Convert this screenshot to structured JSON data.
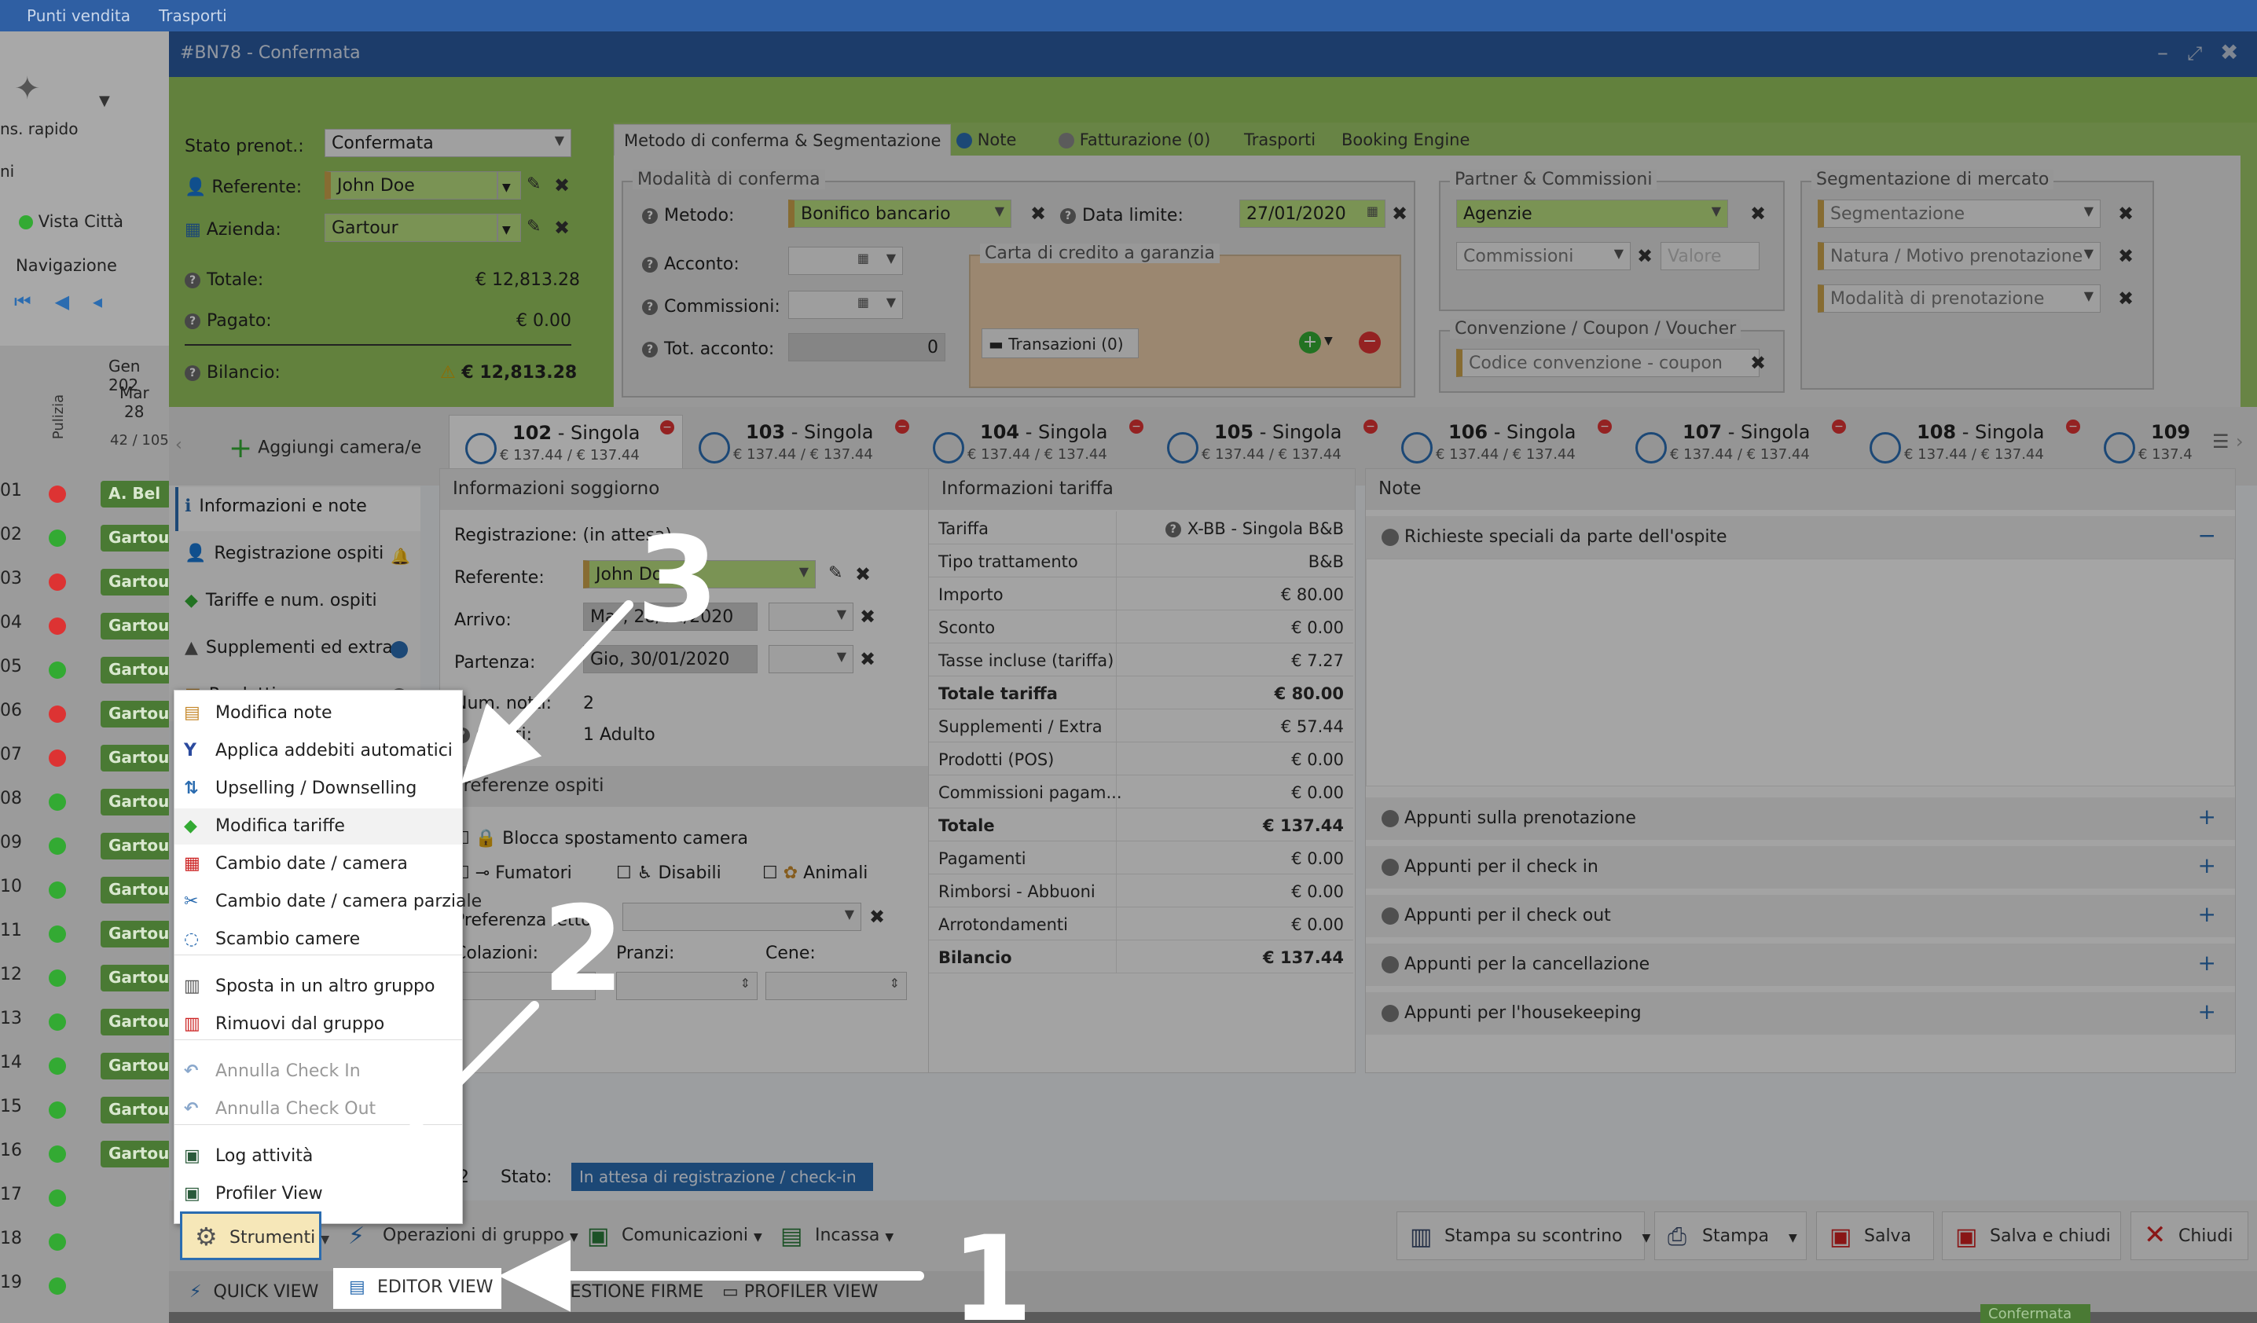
{
  "topbar": {
    "item1": "Punti vendita",
    "item2": "Trasporti"
  },
  "bg_left": {
    "quick": "ns. rapido",
    "ni": "ni",
    "vista": "Vista Città",
    "navigazione": "Navigazione",
    "month": "Gen 202",
    "day": "Mar",
    "daynum": "28",
    "count": "42 / 105",
    "pulizia": "Pulizia",
    "rows": [
      "01",
      "02",
      "03",
      "04",
      "05",
      "06",
      "07",
      "08",
      "09",
      "10",
      "11",
      "12",
      "13",
      "14",
      "15",
      "16",
      "17",
      "18",
      "19"
    ],
    "dots": [
      "#d33",
      "#3a3",
      "#d33",
      "#d33",
      "#3a3",
      "#d33",
      "#d33",
      "#3a3",
      "#3a3",
      "#3a3",
      "#3a3",
      "#3a3",
      "#3a3",
      "#3a3",
      "#3a3",
      "#3a3",
      "#3a3",
      "#3a3",
      "#3a3"
    ],
    "bookings": [
      "A. Bel",
      "Gartou",
      "Gartou",
      "Gartou",
      "Gartou",
      "Gartou",
      "Gartou",
      "Gartou",
      "Gartou",
      "Gartou",
      "Gartou",
      "Gartou",
      "Gartou",
      "Gartou",
      "Gartou",
      "Gartou"
    ]
  },
  "window": {
    "title": "#BN78 - Confermata"
  },
  "booking": {
    "stato_label": "Stato prenot.:",
    "stato_value": "Confermata",
    "referente_label": "Referente:",
    "referente_value": "John Doe",
    "azienda_label": "Azienda:",
    "azienda_value": "Gartour",
    "totale_label": "Totale:",
    "totale_value": "€ 12,813.28",
    "pagato_label": "Pagato:",
    "pagato_value": "€ 0.00",
    "bilancio_label": "Bilancio:",
    "bilancio_value": "€ 12,813.28"
  },
  "tabs": [
    "Metodo di conferma & Segmentazione",
    "Note",
    "Fatturazione (0)",
    "Trasporti",
    "Booking Engine"
  ],
  "conferma": {
    "legend": "Modalità di conferma",
    "metodo_label": "Metodo:",
    "metodo_value": "Bonifico bancario",
    "data_label": "Data limite:",
    "data_value": "27/01/2020",
    "acconto_label": "Acconto:",
    "commissioni_label": "Commissioni:",
    "tot_acconto_label": "Tot. acconto:",
    "tot_acconto_value": "0",
    "carta_legend": "Carta di credito a garanzia",
    "transazioni": "Transazioni (0)"
  },
  "partner": {
    "legend": "Partner & Commissioni",
    "agenzie": "Agenzie",
    "commissioni": "Commissioni",
    "valore": "Valore"
  },
  "segm": {
    "legend": "Segmentazione di mercato",
    "seg": "Segmentazione",
    "natura": "Natura / Motivo prenotazione",
    "modalita": "Modalità di prenotazione"
  },
  "conv": {
    "legend": "Convenzione / Coupon / Voucher",
    "codice": "Codice convenzione - coupon"
  },
  "rooms": {
    "add": "Aggiungi camera/e",
    "list": [
      {
        "num": "102",
        "type": "- Singola",
        "price": "€ 137.44 / € 137.44"
      },
      {
        "num": "103",
        "type": "- Singola",
        "price": "€ 137.44 / € 137.44"
      },
      {
        "num": "104",
        "type": "- Singola",
        "price": "€ 137.44 / € 137.44"
      },
      {
        "num": "105",
        "type": "- Singola",
        "price": "€ 137.44 / € 137.44"
      },
      {
        "num": "106",
        "type": "- Singola",
        "price": "€ 137.44 / € 137.44"
      },
      {
        "num": "107",
        "type": "- Singola",
        "price": "€ 137.44 / € 137.44"
      },
      {
        "num": "108",
        "type": "- Singola",
        "price": "€ 137.44 / € 137.44"
      },
      {
        "num": "109",
        "type": "",
        "price": "€ 137.4"
      }
    ]
  },
  "sidenav": [
    "Informazioni e note",
    "Registrazione ospiti",
    "Tariffe e num. ospiti",
    "Supplementi ed extra",
    "Prodotti"
  ],
  "soggiorno": {
    "title": "Informazioni soggiorno",
    "registrazione_label": "Registrazione:",
    "registrazione_value": "(in attesa)",
    "referente_label": "Referente:",
    "referente_value": "John Doe",
    "arrivo_label": "Arrivo:",
    "arrivo_value": "Mar, 28/01/2020",
    "partenza_label": "Partenza:",
    "partenza_value": "Gio, 30/01/2020",
    "notti_label": "Num. notti:",
    "notti_value": "2",
    "ospiti_label": "Ospiti:",
    "ospiti_value": "1 Adulto",
    "pref_title": "Preferenze ospiti",
    "blocca": "Blocca spostamento camera",
    "fumatori": "Fumatori",
    "disabili": "Disabili",
    "animali": "Animali",
    "pref_letto": "Preferenza letto:",
    "colazioni": "Colazioni:",
    "pranzi": "Pranzi:",
    "cene": "Cene:",
    "ospiti_count": "2",
    "stato_label": "Stato:",
    "stato_value": "In attesa di registrazione / check-in"
  },
  "tariffa": {
    "title": "Informazioni tariffa",
    "rows": [
      [
        "Tariffa",
        "X-BB - Singola B&B"
      ],
      [
        "Tipo trattamento",
        "B&B"
      ],
      [
        "Importo",
        "€ 80.00"
      ],
      [
        "Sconto",
        "€ 0.00"
      ],
      [
        "Tasse incluse (tariffa)",
        "€ 7.27"
      ],
      [
        "Totale tariffa",
        "€ 80.00"
      ],
      [
        "Supplementi / Extra",
        "€ 57.44"
      ],
      [
        "Prodotti (POS)",
        "€ 0.00"
      ],
      [
        "Commissioni pagam...",
        "€ 0.00"
      ],
      [
        "Totale",
        "€ 137.44"
      ],
      [
        "Pagamenti",
        "€ 0.00"
      ],
      [
        "Rimborsi - Abbuoni",
        "€ 0.00"
      ],
      [
        "Arrotondamenti",
        "€ 0.00"
      ],
      [
        "Bilancio",
        "€ 137.44"
      ]
    ]
  },
  "note": {
    "title": "Note",
    "richieste": "Richieste speciali da parte dell'ospite",
    "items": [
      "Appunti sulla prenotazione",
      "Appunti per il check in",
      "Appunti per il check out",
      "Appunti per la cancellazione",
      "Appunti per l'housekeeping"
    ]
  },
  "menu": {
    "items": [
      "Modifica note",
      "Applica addebiti automatici",
      "Upselling / Downselling",
      "Modifica tariffe",
      "Cambio date / camera",
      "Cambio date / camera parziale",
      "Scambio camere",
      "Sposta in un altro gruppo",
      "Rimuovi dal gruppo",
      "Annulla Check In",
      "Annulla Check Out",
      "Log attività",
      "Profiler View"
    ]
  },
  "toolbar": {
    "strumenti": "Strumenti",
    "operazioni": "Operazioni di gruppo",
    "comunicazioni": "Comunicazioni",
    "incassa": "Incassa",
    "stampa_scontrino": "Stampa su scontrino",
    "stampa": "Stampa",
    "salva": "Salva",
    "salva_chiudi": "Salva e chiudi",
    "chiudi": "Chiudi"
  },
  "bottom": {
    "quick": "QUICK VIEW",
    "editor": "EDITOR VIEW",
    "firme": "GESTIONE FIRME",
    "profiler": "PROFILER VIEW",
    "confermata": "Confermata"
  },
  "annotations": {
    "one": "1",
    "two": "2",
    "three": "3"
  },
  "colors": {
    "accent_green": "#93c05c",
    "field_green": "#b7dc7e",
    "title_blue": "#2b5a9e",
    "remove_red": "#d33"
  }
}
